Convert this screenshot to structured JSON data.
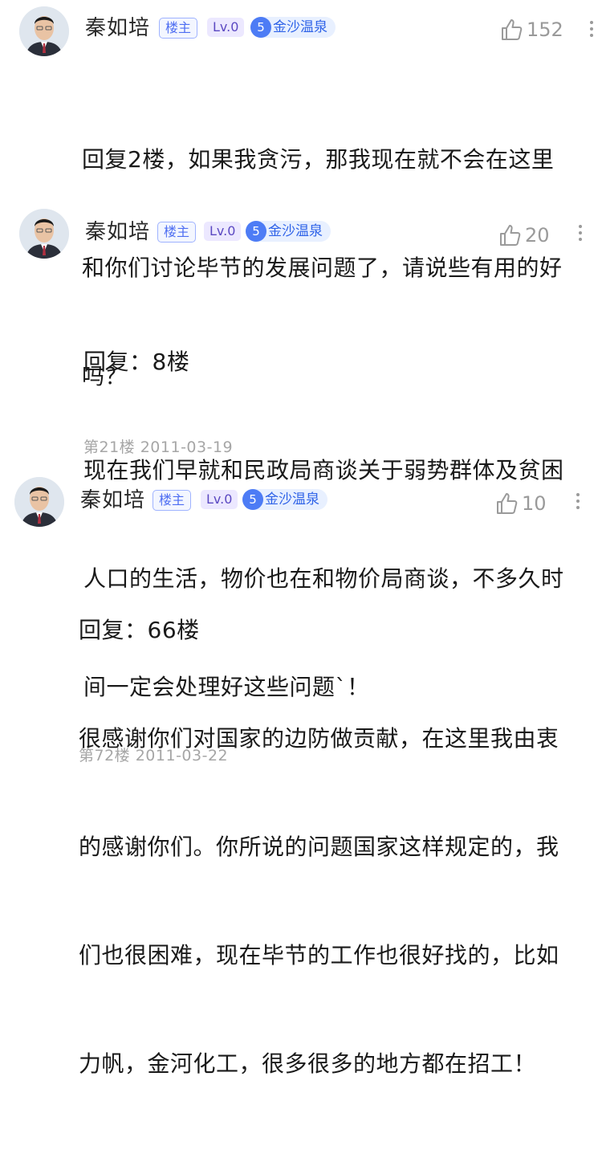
{
  "posts": [
    {
      "author": "秦如培",
      "owner_badge": "楼主",
      "level": "Lv.0",
      "bar_level": "5",
      "bar_name": "金沙温泉",
      "likes": "152",
      "lines": [
        "回复2楼，如果我贪污，那我现在就不会在这里",
        "和你们讨论毕节的发展问题了，请说些有用的好",
        "吗？"
      ],
      "meta": ""
    },
    {
      "author": "秦如培",
      "owner_badge": "楼主",
      "level": "Lv.0",
      "bar_level": "5",
      "bar_name": "金沙温泉",
      "likes": "20",
      "lines": [
        "回复：8楼",
        "现在我们早就和民政局商谈关于弱势群体及贫困",
        "人口的生活，物价也在和物价局商谈，不多久时",
        "间一定会处理好这些问题`！"
      ],
      "meta": "第21楼  2011-03-19"
    },
    {
      "author": "秦如培",
      "owner_badge": "楼主",
      "level": "Lv.0",
      "bar_level": "5",
      "bar_name": "金沙温泉",
      "likes": "10",
      "lines": [
        "回复：66楼",
        "很感谢你们对国家的边防做贡献，在这里我由衷",
        "的感谢你们。你所说的问题国家这样规定的，我",
        "们也很困难，现在毕节的工作也很好找的，比如",
        "力帆，金河化工，很多很多的地方都在招工！"
      ],
      "meta": "第72楼  2011-03-22"
    }
  ]
}
